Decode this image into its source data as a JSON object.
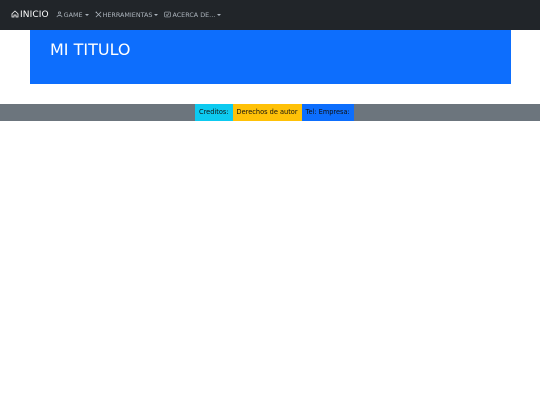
{
  "navbar": {
    "brand": {
      "icon": "house-icon",
      "label": "INICIO"
    },
    "items": [
      {
        "icon": "person-icon",
        "label": "GAME"
      },
      {
        "icon": "tools-icon",
        "label": "HERRAMIENTAS"
      },
      {
        "icon": "info-card-icon",
        "label": "ACERCA DE..."
      }
    ]
  },
  "hero": {
    "title": "MI TITULO"
  },
  "footer": {
    "badges": [
      {
        "label": "Creditos:",
        "color": "#0dcaf0"
      },
      {
        "label": "Derechos de autor",
        "color": "#ffc107"
      },
      {
        "label": "Tel: Empresa:",
        "color": "#0d6efd"
      }
    ]
  },
  "colors": {
    "navbar_bg": "#212529",
    "hero_bg": "#0d6efd",
    "footer_bg": "#6c757d"
  }
}
